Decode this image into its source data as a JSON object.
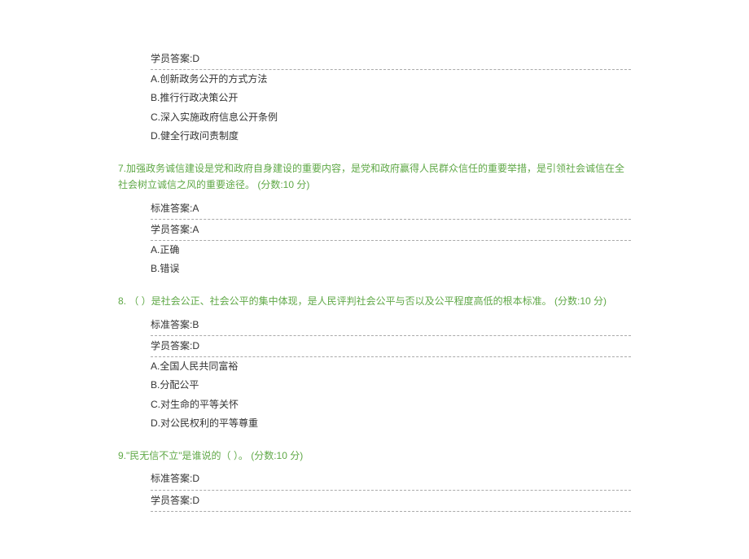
{
  "q6": {
    "student_answer_label": "学员答案:D",
    "options": {
      "a": "A.创新政务公开的方式方法",
      "b": "B.推行行政决策公开",
      "c": "C.深入实施政府信息公开条例",
      "d": "D.健全行政问责制度"
    }
  },
  "q7": {
    "title": "7.加强政务诚信建设是党和政府自身建设的重要内容，是党和政府赢得人民群众信任的重要举措，是引领社会诚信在全社会树立诚信之风的重要途径。 (分数:10 分)",
    "standard_answer_label": "标准答案:A",
    "student_answer_label": "学员答案:A",
    "options": {
      "a": "A.正确",
      "b": "B.错误"
    }
  },
  "q8": {
    "title": "8. （  ）是社会公正、社会公平的集中体现，是人民评判社会公平与否以及公平程度高低的根本标准。 (分数:10 分)",
    "standard_answer_label": "标准答案:B",
    "student_answer_label": "学员答案:D",
    "options": {
      "a": "A.全国人民共同富裕",
      "b": "B.分配公平",
      "c": "C.对生命的平等关怀",
      "d": "D.对公民权利的平等尊重"
    }
  },
  "q9": {
    "title": "9.\"民无信不立\"是谁说的（  ）。 (分数:10 分)",
    "standard_answer_label": "标准答案:D",
    "student_answer_label": "学员答案:D"
  }
}
